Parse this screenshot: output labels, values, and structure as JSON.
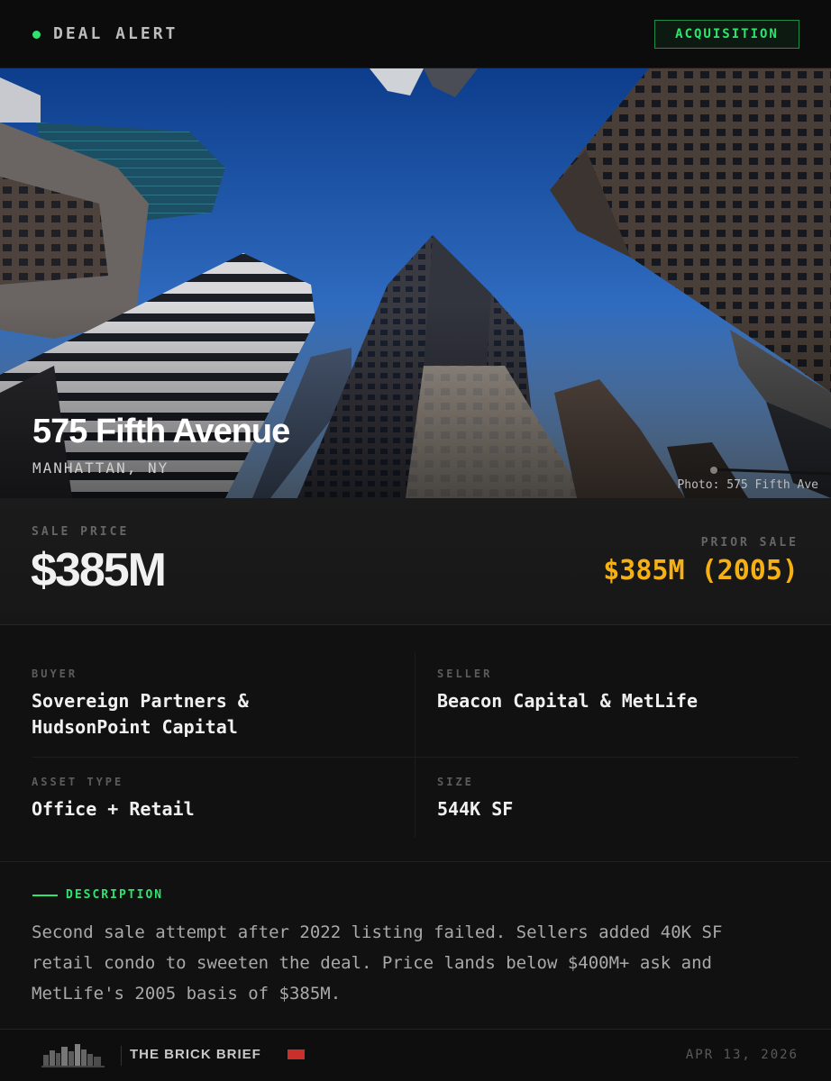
{
  "header": {
    "title": "DEAL ALERT",
    "badge": "ACQUISITION",
    "accent_color": "#2ee46e"
  },
  "hero": {
    "property_name": "575 Fifth Avenue",
    "location": "MANHATTAN, NY",
    "photo_credit": "Photo: 575 Fifth Ave"
  },
  "pricing": {
    "sale_label": "SALE PRICE",
    "sale_value": "$385M",
    "prior_label": "PRIOR SALE",
    "prior_value": "$385M (2005)",
    "prior_color": "#f5b014"
  },
  "details": {
    "buyer_label": "BUYER",
    "buyer_line1": "Sovereign Partners &",
    "buyer_line2": "HudsonPoint Capital",
    "seller_label": "SELLER",
    "seller": "Beacon Capital & MetLife",
    "asset_label": "ASSET TYPE",
    "asset": "Office + Retail",
    "size_label": "SIZE",
    "size": "544K SF"
  },
  "description": {
    "label": "DESCRIPTION",
    "line1": "Second sale attempt after 2022 listing failed. Sellers added 40K SF",
    "line2": "retail condo to sweeten the deal. Price lands below $400M+ ask and",
    "line3": "MetLife's 2005 basis of $385M."
  },
  "footer": {
    "brand": "THE BRICK BRIEF",
    "date": "APR 13, 2026",
    "brand_accent": "#c9302c"
  }
}
